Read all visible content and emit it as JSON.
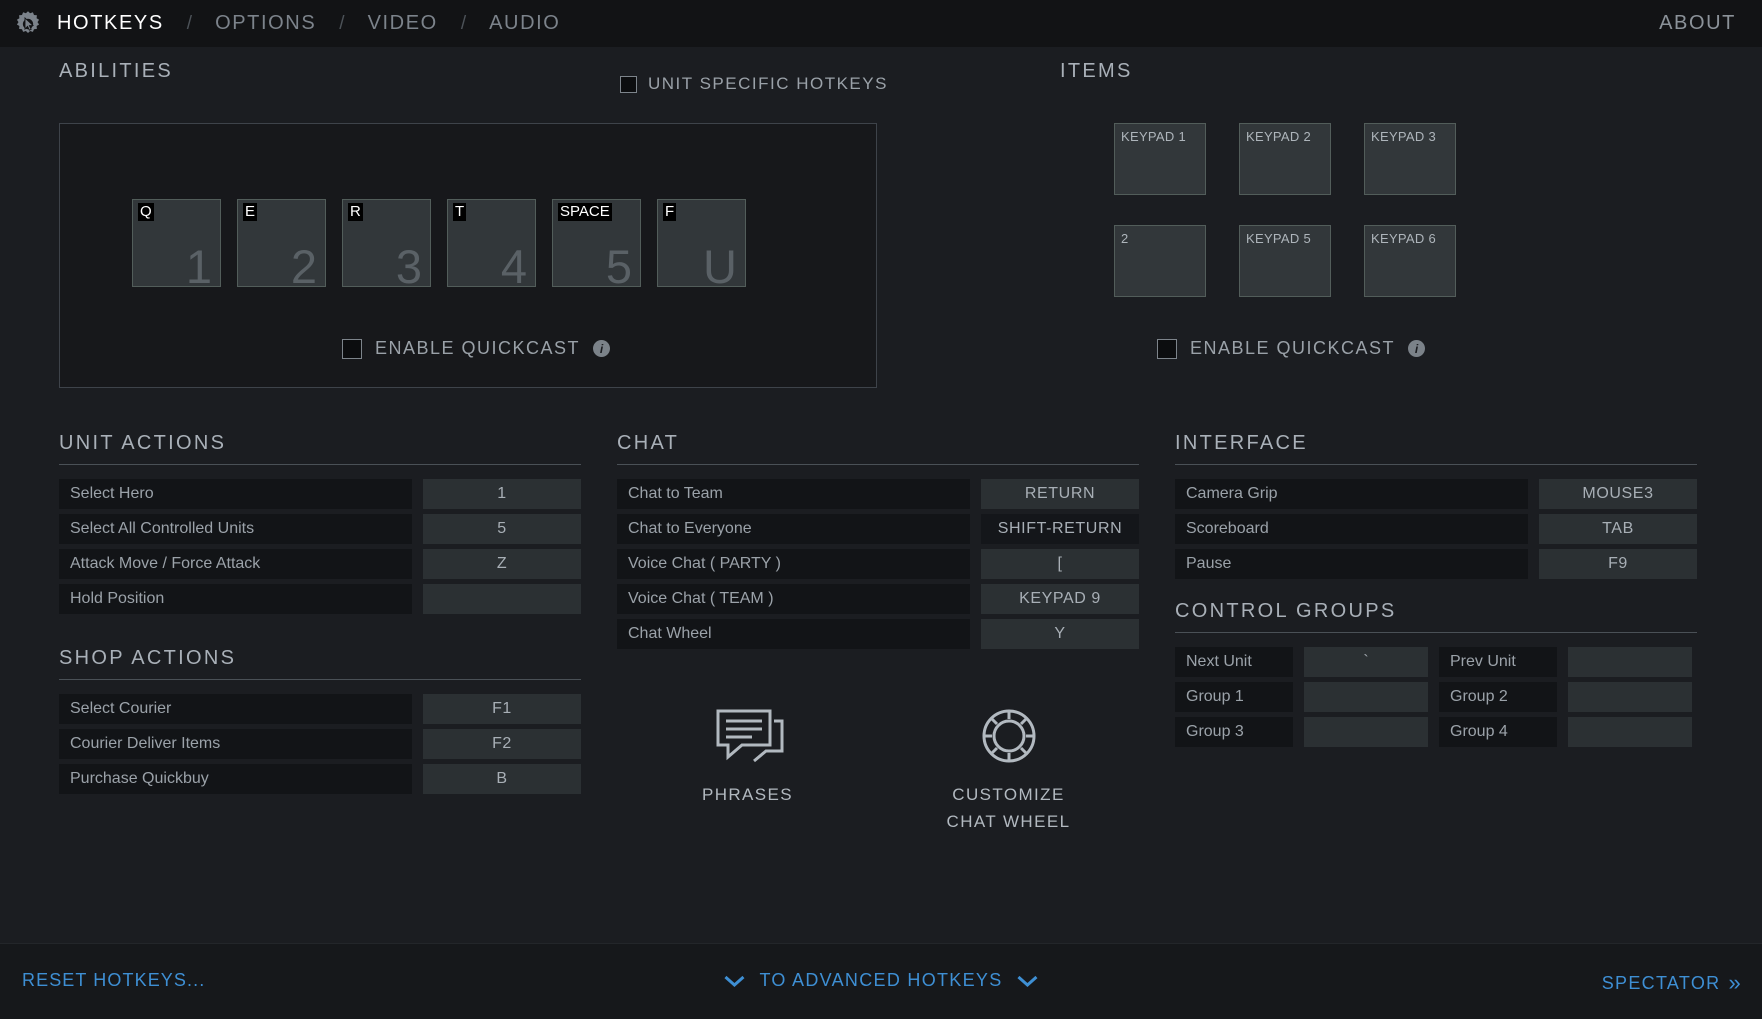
{
  "topnav": {
    "gear_icon": "gear-icon",
    "tabs": [
      {
        "label": "HOTKEYS",
        "active": true
      },
      {
        "label": "OPTIONS",
        "active": false
      },
      {
        "label": "VIDEO",
        "active": false
      },
      {
        "label": "AUDIO",
        "active": false
      }
    ],
    "separator": "/",
    "about_label": "ABOUT"
  },
  "abilities": {
    "title": "ABILITIES",
    "unit_specific_label": "UNIT SPECIFIC HOTKEYS",
    "unit_specific_checked": false,
    "quickcast_label": "ENABLE QUICKCAST",
    "quickcast_checked": false,
    "info_glyph": "i",
    "slots": [
      {
        "key": "Q",
        "num": "1"
      },
      {
        "key": "E",
        "num": "2"
      },
      {
        "key": "R",
        "num": "3"
      },
      {
        "key": "T",
        "num": "4"
      },
      {
        "key": "SPACE",
        "num": "5"
      },
      {
        "key": "F",
        "num": "U"
      }
    ]
  },
  "items": {
    "title": "ITEMS",
    "quickcast_label": "ENABLE QUICKCAST",
    "quickcast_checked": false,
    "info_glyph": "i",
    "slots": [
      {
        "key": "KEYPAD 1"
      },
      {
        "key": "KEYPAD 2"
      },
      {
        "key": "KEYPAD 3"
      },
      {
        "key": "2"
      },
      {
        "key": "KEYPAD 5"
      },
      {
        "key": "KEYPAD 6"
      }
    ]
  },
  "unit_actions": {
    "title": "UNIT ACTIONS",
    "rows": [
      {
        "label": "Select Hero",
        "key": "1",
        "dark": false
      },
      {
        "label": "Select All Controlled Units",
        "key": "5",
        "dark": false
      },
      {
        "label": "Attack Move / Force Attack",
        "key": "Z",
        "dark": false
      },
      {
        "label": "Hold Position",
        "key": "",
        "dark": false
      }
    ]
  },
  "shop_actions": {
    "title": "SHOP ACTIONS",
    "rows": [
      {
        "label": "Select Courier",
        "key": "F1",
        "dark": false
      },
      {
        "label": "Courier Deliver Items",
        "key": "F2",
        "dark": false
      },
      {
        "label": "Purchase Quickbuy",
        "key": "B",
        "dark": false
      }
    ]
  },
  "chat": {
    "title": "CHAT",
    "rows": [
      {
        "label": "Chat to Team",
        "key": "RETURN",
        "dark": false
      },
      {
        "label": "Chat to Everyone",
        "key": "SHIFT-RETURN",
        "dark": true
      },
      {
        "label": "Voice Chat ( PARTY )",
        "key": "[",
        "dark": false
      },
      {
        "label": "Voice Chat ( TEAM )",
        "key": "KEYPAD 9",
        "dark": false
      },
      {
        "label": "Chat Wheel",
        "key": "Y",
        "dark": false
      }
    ],
    "buttons": [
      {
        "label": "PHRASES",
        "icon": "speech-bubbles-icon"
      },
      {
        "label": "CUSTOMIZE\nCHAT WHEEL",
        "icon": "chat-wheel-icon"
      }
    ]
  },
  "interface": {
    "title": "INTERFACE",
    "rows": [
      {
        "label": "Camera Grip",
        "key": "MOUSE3",
        "dark": false
      },
      {
        "label": "Scoreboard",
        "key": "TAB",
        "dark": false
      },
      {
        "label": "Pause",
        "key": "F9",
        "dark": false
      }
    ]
  },
  "control_groups": {
    "title": "CONTROL GROUPS",
    "rows": [
      {
        "label_a": "Next Unit",
        "key_a": "`",
        "label_b": "Prev Unit",
        "key_b": ""
      },
      {
        "label_a": "Group 1",
        "key_a": "",
        "label_b": "Group 2",
        "key_b": ""
      },
      {
        "label_a": "Group 3",
        "key_a": "",
        "label_b": "Group 4",
        "key_b": ""
      }
    ]
  },
  "footer": {
    "reset_label": "RESET HOTKEYS...",
    "advanced_label": "TO ADVANCED HOTKEYS",
    "spectator_label": "SPECTATOR",
    "spectator_chevron": "»"
  },
  "colors": {
    "accent_link": "#3e8fd4",
    "panel_bg": "#17181b",
    "page_bg": "#1b1d21",
    "slot_bg": "#32373a",
    "key_bg": "#2b3033"
  }
}
